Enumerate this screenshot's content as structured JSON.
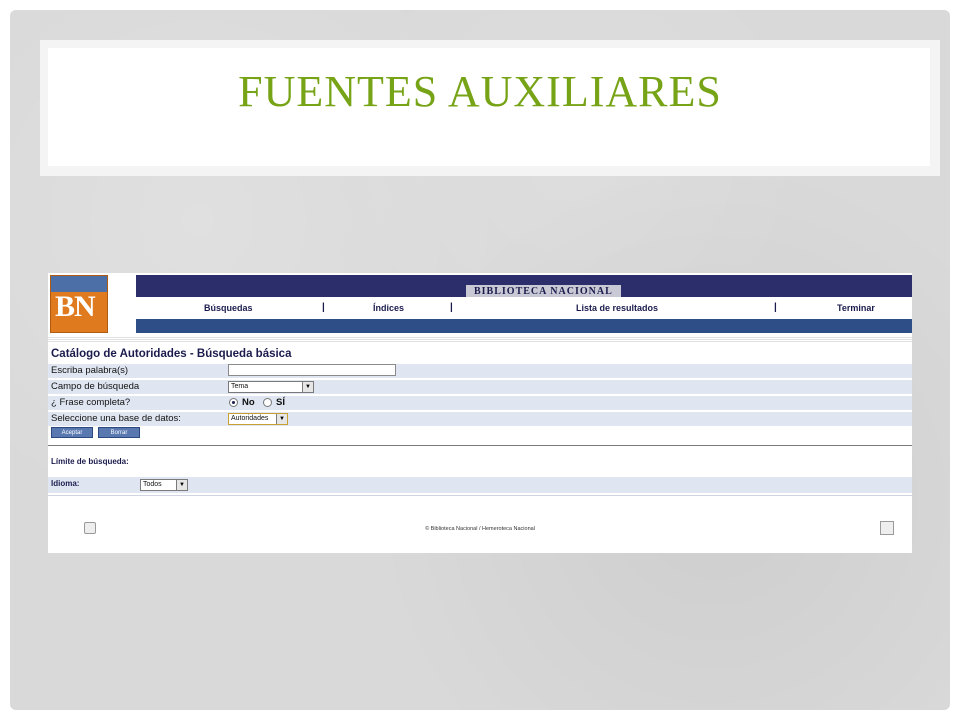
{
  "slide": {
    "title": "FUENTES AUXILIARES"
  },
  "app": {
    "logo": "BN",
    "header_title": "BIBLIOTECA NACIONAL",
    "nav": [
      "Búsquedas",
      "Índices",
      "Lista de resultados",
      "Terminar"
    ],
    "nav_separator": "|"
  },
  "form": {
    "title": "Catálogo de Autoridades - Búsqueda básica",
    "word_label": "Escriba palabra(s)",
    "word_value": "",
    "field_label": "Campo de búsqueda",
    "field_value": "Tema",
    "phrase_label": "¿ Frase completa?",
    "phrase_no": "No",
    "phrase_yes": "SÍ",
    "db_label": "Seleccione una base de datos:",
    "db_value": "Autoridades",
    "accept_button": "Aceptar",
    "clear_button": "Borrar"
  },
  "limit": {
    "title": "Límite de búsqueda:",
    "language_label": "Idioma:",
    "language_value": "Todos"
  },
  "footer": {
    "copyright": "© Biblioteca Nacional / Hemeroteca Nacional"
  },
  "colors": {
    "title": "#77a316",
    "header_bar": "#2c2d6b",
    "nav_bar": "#2d4e86",
    "row_bg": "#dfe6f1"
  }
}
